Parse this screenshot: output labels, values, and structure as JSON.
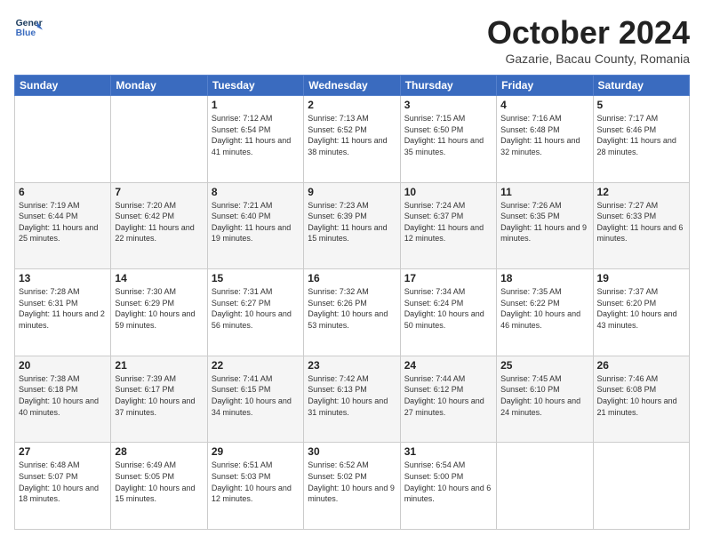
{
  "header": {
    "logo_line1": "General",
    "logo_line2": "Blue",
    "month": "October 2024",
    "location": "Gazarie, Bacau County, Romania"
  },
  "weekdays": [
    "Sunday",
    "Monday",
    "Tuesday",
    "Wednesday",
    "Thursday",
    "Friday",
    "Saturday"
  ],
  "weeks": [
    [
      {
        "day": "",
        "content": ""
      },
      {
        "day": "",
        "content": ""
      },
      {
        "day": "1",
        "content": "Sunrise: 7:12 AM\nSunset: 6:54 PM\nDaylight: 11 hours and 41 minutes."
      },
      {
        "day": "2",
        "content": "Sunrise: 7:13 AM\nSunset: 6:52 PM\nDaylight: 11 hours and 38 minutes."
      },
      {
        "day": "3",
        "content": "Sunrise: 7:15 AM\nSunset: 6:50 PM\nDaylight: 11 hours and 35 minutes."
      },
      {
        "day": "4",
        "content": "Sunrise: 7:16 AM\nSunset: 6:48 PM\nDaylight: 11 hours and 32 minutes."
      },
      {
        "day": "5",
        "content": "Sunrise: 7:17 AM\nSunset: 6:46 PM\nDaylight: 11 hours and 28 minutes."
      }
    ],
    [
      {
        "day": "6",
        "content": "Sunrise: 7:19 AM\nSunset: 6:44 PM\nDaylight: 11 hours and 25 minutes."
      },
      {
        "day": "7",
        "content": "Sunrise: 7:20 AM\nSunset: 6:42 PM\nDaylight: 11 hours and 22 minutes."
      },
      {
        "day": "8",
        "content": "Sunrise: 7:21 AM\nSunset: 6:40 PM\nDaylight: 11 hours and 19 minutes."
      },
      {
        "day": "9",
        "content": "Sunrise: 7:23 AM\nSunset: 6:39 PM\nDaylight: 11 hours and 15 minutes."
      },
      {
        "day": "10",
        "content": "Sunrise: 7:24 AM\nSunset: 6:37 PM\nDaylight: 11 hours and 12 minutes."
      },
      {
        "day": "11",
        "content": "Sunrise: 7:26 AM\nSunset: 6:35 PM\nDaylight: 11 hours and 9 minutes."
      },
      {
        "day": "12",
        "content": "Sunrise: 7:27 AM\nSunset: 6:33 PM\nDaylight: 11 hours and 6 minutes."
      }
    ],
    [
      {
        "day": "13",
        "content": "Sunrise: 7:28 AM\nSunset: 6:31 PM\nDaylight: 11 hours and 2 minutes."
      },
      {
        "day": "14",
        "content": "Sunrise: 7:30 AM\nSunset: 6:29 PM\nDaylight: 10 hours and 59 minutes."
      },
      {
        "day": "15",
        "content": "Sunrise: 7:31 AM\nSunset: 6:27 PM\nDaylight: 10 hours and 56 minutes."
      },
      {
        "day": "16",
        "content": "Sunrise: 7:32 AM\nSunset: 6:26 PM\nDaylight: 10 hours and 53 minutes."
      },
      {
        "day": "17",
        "content": "Sunrise: 7:34 AM\nSunset: 6:24 PM\nDaylight: 10 hours and 50 minutes."
      },
      {
        "day": "18",
        "content": "Sunrise: 7:35 AM\nSunset: 6:22 PM\nDaylight: 10 hours and 46 minutes."
      },
      {
        "day": "19",
        "content": "Sunrise: 7:37 AM\nSunset: 6:20 PM\nDaylight: 10 hours and 43 minutes."
      }
    ],
    [
      {
        "day": "20",
        "content": "Sunrise: 7:38 AM\nSunset: 6:18 PM\nDaylight: 10 hours and 40 minutes."
      },
      {
        "day": "21",
        "content": "Sunrise: 7:39 AM\nSunset: 6:17 PM\nDaylight: 10 hours and 37 minutes."
      },
      {
        "day": "22",
        "content": "Sunrise: 7:41 AM\nSunset: 6:15 PM\nDaylight: 10 hours and 34 minutes."
      },
      {
        "day": "23",
        "content": "Sunrise: 7:42 AM\nSunset: 6:13 PM\nDaylight: 10 hours and 31 minutes."
      },
      {
        "day": "24",
        "content": "Sunrise: 7:44 AM\nSunset: 6:12 PM\nDaylight: 10 hours and 27 minutes."
      },
      {
        "day": "25",
        "content": "Sunrise: 7:45 AM\nSunset: 6:10 PM\nDaylight: 10 hours and 24 minutes."
      },
      {
        "day": "26",
        "content": "Sunrise: 7:46 AM\nSunset: 6:08 PM\nDaylight: 10 hours and 21 minutes."
      }
    ],
    [
      {
        "day": "27",
        "content": "Sunrise: 6:48 AM\nSunset: 5:07 PM\nDaylight: 10 hours and 18 minutes."
      },
      {
        "day": "28",
        "content": "Sunrise: 6:49 AM\nSunset: 5:05 PM\nDaylight: 10 hours and 15 minutes."
      },
      {
        "day": "29",
        "content": "Sunrise: 6:51 AM\nSunset: 5:03 PM\nDaylight: 10 hours and 12 minutes."
      },
      {
        "day": "30",
        "content": "Sunrise: 6:52 AM\nSunset: 5:02 PM\nDaylight: 10 hours and 9 minutes."
      },
      {
        "day": "31",
        "content": "Sunrise: 6:54 AM\nSunset: 5:00 PM\nDaylight: 10 hours and 6 minutes."
      },
      {
        "day": "",
        "content": ""
      },
      {
        "day": "",
        "content": ""
      }
    ]
  ]
}
